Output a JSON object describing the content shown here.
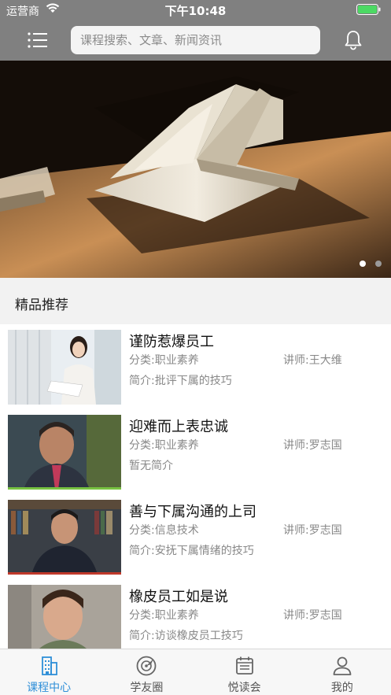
{
  "status_bar": {
    "carrier": "运营商",
    "time": "下午10:48"
  },
  "search": {
    "placeholder": "课程搜索、文章、新闻资讯"
  },
  "icons": {
    "menu": "menu-icon",
    "notification": "bell-icon",
    "wifi": "wifi-icon",
    "battery": "battery-icon"
  },
  "banner": {
    "slide_count": 2,
    "active_index": 0
  },
  "section": {
    "title": "精品推荐"
  },
  "courses": [
    {
      "title": "谨防惹爆员工",
      "category": "分类:职业素养",
      "teacher": "讲师:王大维",
      "intro": "简介:批评下属的技巧"
    },
    {
      "title": "迎难而上表忠诚",
      "category": "分类:职业素养",
      "teacher": "讲师:罗志国",
      "intro": "暂无简介"
    },
    {
      "title": "善与下属沟通的上司",
      "category": "分类:信息技术",
      "teacher": "讲师:罗志国",
      "intro": "简介:安抚下属情绪的技巧"
    },
    {
      "title": "橡皮员工如是说",
      "category": "分类:职业素养",
      "teacher": "讲师:罗志国",
      "intro": "简介:访谈橡皮员工技巧"
    }
  ],
  "tabs": [
    {
      "label": "课程中心",
      "icon": "building-icon",
      "active": true
    },
    {
      "label": "学友圈",
      "icon": "compass-icon",
      "active": false
    },
    {
      "label": "悦读会",
      "icon": "calendar-icon",
      "active": false
    },
    {
      "label": "我的",
      "icon": "user-icon",
      "active": false
    }
  ],
  "colors": {
    "header_bg": "#808080",
    "accent": "#2f8fd8",
    "section_bg": "#f2f2f2",
    "battery": "#4cd964"
  }
}
